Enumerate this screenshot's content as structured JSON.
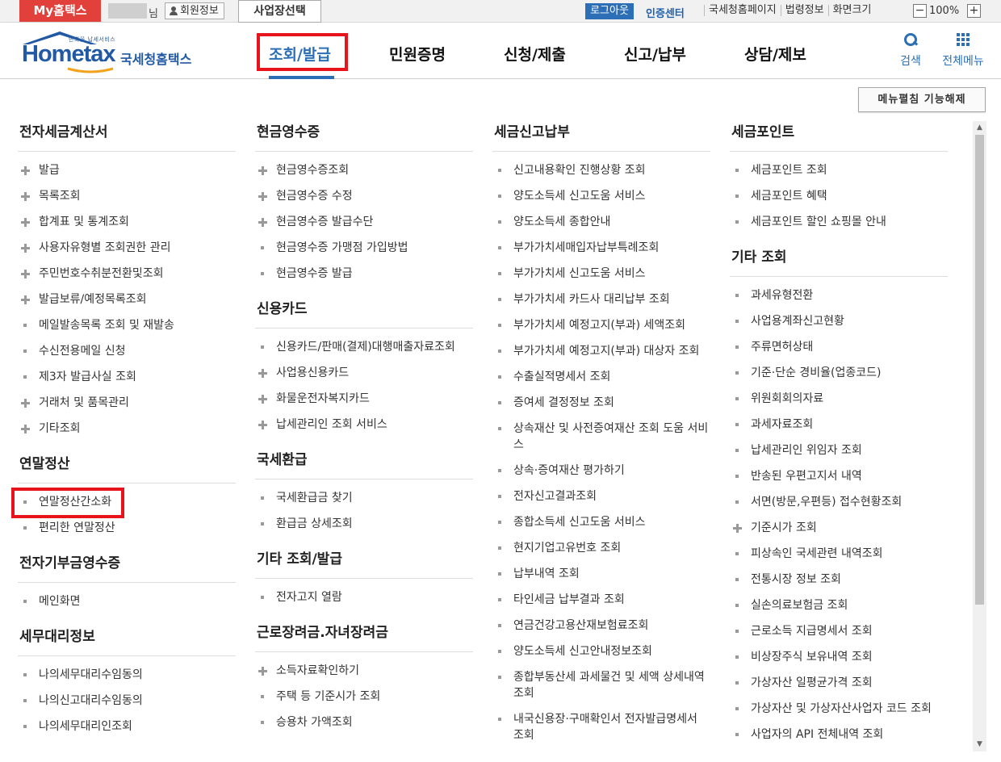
{
  "topbar": {
    "my_home": "My홈택스",
    "user_suffix": "님",
    "member_info": "회원정보",
    "business_select": "사업장선택",
    "logout": "로그아웃",
    "certificate_center": "인증센터",
    "links": [
      "국세청홈페이지",
      "법령정보",
      "화면크기"
    ],
    "zoom_value": "100%",
    "zoom_minus": "−",
    "zoom_plus": "+"
  },
  "header": {
    "logo_small": "만화웃 납세서비스",
    "logo_home": "Hometax",
    "logo_korean": "국세청홈택스",
    "nav": [
      "조회/발급",
      "민원증명",
      "신청/제출",
      "신고/납부",
      "상담/제보"
    ],
    "search_label": "검색",
    "all_menu_label": "전체메뉴"
  },
  "unfold_button": "메뉴펼침 기능해제",
  "columns": [
    {
      "sections": [
        {
          "title": "전자세금계산서",
          "items": [
            {
              "label": "발급",
              "bullet": "plus"
            },
            {
              "label": "목록조회",
              "bullet": "plus"
            },
            {
              "label": "합계표 및 통계조회",
              "bullet": "plus"
            },
            {
              "label": "사용자유형별 조회권한 관리",
              "bullet": "plus"
            },
            {
              "label": "주민번호수취분전환및조회",
              "bullet": "plus"
            },
            {
              "label": "발급보류/예정목록조회",
              "bullet": "plus"
            },
            {
              "label": "메일발송목록 조회 및 재발송",
              "bullet": "dot"
            },
            {
              "label": "수신전용메일 신청",
              "bullet": "dot"
            },
            {
              "label": "제3자 발급사실 조회",
              "bullet": "dot"
            },
            {
              "label": "거래처 및 품목관리",
              "bullet": "plus"
            },
            {
              "label": "기타조회",
              "bullet": "plus"
            }
          ]
        },
        {
          "title": "연말정산",
          "items": [
            {
              "label": "연말정산간소화",
              "bullet": "dot",
              "highlight": true
            },
            {
              "label": "편리한 연말정산",
              "bullet": "dot"
            }
          ]
        },
        {
          "title": "전자기부금영수증",
          "items": [
            {
              "label": "메인화면",
              "bullet": "dot"
            }
          ]
        },
        {
          "title": "세무대리정보",
          "items": [
            {
              "label": "나의세무대리수임동의",
              "bullet": "dot"
            },
            {
              "label": "나의신고대리수임동의",
              "bullet": "dot"
            },
            {
              "label": "나의세무대리인조회",
              "bullet": "dot"
            }
          ]
        }
      ]
    },
    {
      "sections": [
        {
          "title": "현금영수증",
          "items": [
            {
              "label": "현금영수증조회",
              "bullet": "plus"
            },
            {
              "label": "현금영수증 수정",
              "bullet": "plus"
            },
            {
              "label": "현금영수증 발급수단",
              "bullet": "plus"
            },
            {
              "label": "현금영수증 가맹점 가입방법",
              "bullet": "dot"
            },
            {
              "label": "현금영수증 발급",
              "bullet": "dot"
            }
          ]
        },
        {
          "title": "신용카드",
          "items": [
            {
              "label": "신용카드/판매(결제)대행매출자료조회",
              "bullet": "dot"
            },
            {
              "label": "사업용신용카드",
              "bullet": "plus"
            },
            {
              "label": "화물운전자복지카드",
              "bullet": "plus"
            },
            {
              "label": "납세관리인 조회 서비스",
              "bullet": "plus"
            }
          ]
        },
        {
          "title": "국세환급",
          "items": [
            {
              "label": "국세환급금 찾기",
              "bullet": "dot"
            },
            {
              "label": "환급금 상세조회",
              "bullet": "dot"
            }
          ]
        },
        {
          "title": "기타 조회/발급",
          "items": [
            {
              "label": "전자고지 열람",
              "bullet": "dot"
            }
          ]
        },
        {
          "title": "근로장려금.자녀장려금",
          "items": [
            {
              "label": "소득자료확인하기",
              "bullet": "plus"
            },
            {
              "label": "주택 등 기준시가 조회",
              "bullet": "dot"
            },
            {
              "label": "승용차 가액조회",
              "bullet": "dot"
            }
          ]
        }
      ]
    },
    {
      "sections": [
        {
          "title": "세금신고납부",
          "items": [
            {
              "label": "신고내용확인 진행상황 조회",
              "bullet": "dot"
            },
            {
              "label": "양도소득세 신고도움 서비스",
              "bullet": "dot"
            },
            {
              "label": "양도소득세 종합안내",
              "bullet": "dot"
            },
            {
              "label": "부가가치세매입자납부특례조회",
              "bullet": "dot"
            },
            {
              "label": "부가가치세 신고도움 서비스",
              "bullet": "dot"
            },
            {
              "label": "부가가치세 카드사 대리납부 조회",
              "bullet": "dot"
            },
            {
              "label": "부가가치세 예정고지(부과) 세액조회",
              "bullet": "dot"
            },
            {
              "label": "부가가치세 예정고지(부과) 대상자 조회",
              "bullet": "dot"
            },
            {
              "label": "수출실적명세서 조회",
              "bullet": "dot"
            },
            {
              "label": "증여세 결정정보 조회",
              "bullet": "dot"
            },
            {
              "label": "상속재산 및 사전증여재산 조회 도움 서비스",
              "bullet": "dot"
            },
            {
              "label": "상속·증여재산 평가하기",
              "bullet": "dot"
            },
            {
              "label": "전자신고결과조회",
              "bullet": "dot"
            },
            {
              "label": "종합소득세 신고도움 서비스",
              "bullet": "dot"
            },
            {
              "label": "현지기업고유번호 조회",
              "bullet": "dot"
            },
            {
              "label": "납부내역 조회",
              "bullet": "dot"
            },
            {
              "label": "타인세금 납부결과 조회",
              "bullet": "dot"
            },
            {
              "label": "연금건강고용산재보험료조회",
              "bullet": "dot"
            },
            {
              "label": "양도소득세 신고안내정보조회",
              "bullet": "dot"
            },
            {
              "label": "종합부동산세 과세물건 및 세액 상세내역 조회",
              "bullet": "dot"
            },
            {
              "label": "내국신용장·구매확인서 전자발급명세서 조회",
              "bullet": "dot"
            }
          ]
        }
      ]
    },
    {
      "sections": [
        {
          "title": "세금포인트",
          "items": [
            {
              "label": "세금포인트 조회",
              "bullet": "dot"
            },
            {
              "label": "세금포인트 혜택",
              "bullet": "dot"
            },
            {
              "label": "세금포인트 할인 쇼핑몰 안내",
              "bullet": "dot"
            }
          ]
        },
        {
          "title": "기타 조회",
          "items": [
            {
              "label": "과세유형전환",
              "bullet": "dot"
            },
            {
              "label": "사업용계좌신고현황",
              "bullet": "dot"
            },
            {
              "label": "주류면허상태",
              "bullet": "dot"
            },
            {
              "label": "기준·단순 경비율(업종코드)",
              "bullet": "dot"
            },
            {
              "label": "위원회회의자료",
              "bullet": "dot"
            },
            {
              "label": "과세자료조회",
              "bullet": "dot"
            },
            {
              "label": "납세관리인 위임자 조회",
              "bullet": "dot"
            },
            {
              "label": "반송된 우편고지서 내역",
              "bullet": "dot"
            },
            {
              "label": "서면(방문,우편등) 접수현황조회",
              "bullet": "dot"
            },
            {
              "label": "기준시가 조회",
              "bullet": "plus"
            },
            {
              "label": "피상속인 국세관련 내역조회",
              "bullet": "dot"
            },
            {
              "label": "전통시장 정보 조회",
              "bullet": "dot"
            },
            {
              "label": "실손의료보험금 조회",
              "bullet": "dot"
            },
            {
              "label": "근로소득 지급명세서 조회",
              "bullet": "dot"
            },
            {
              "label": "비상장주식 보유내역 조회",
              "bullet": "dot"
            },
            {
              "label": "가상자산 일평균가격 조회",
              "bullet": "dot"
            },
            {
              "label": "가상자산 및 가상자산사업자 코드 조회",
              "bullet": "dot"
            },
            {
              "label": "사업자의 API 전체내역 조회",
              "bullet": "dot"
            }
          ]
        }
      ]
    }
  ]
}
